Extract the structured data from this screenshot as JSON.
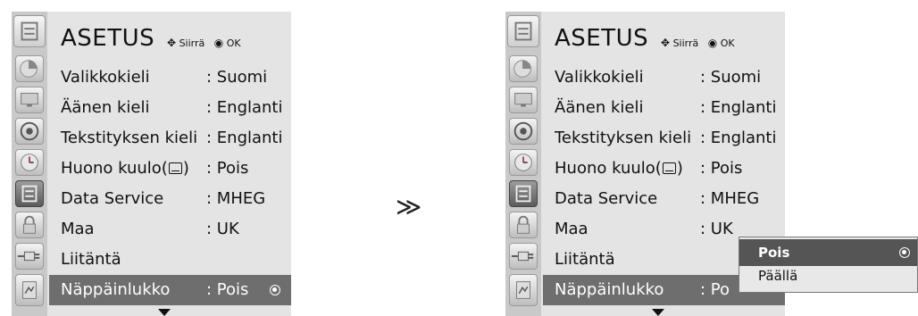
{
  "left_panel": {
    "title": "ASETUS",
    "hint_move": "Siirrä",
    "hint_ok": "OK",
    "rows": [
      {
        "label": "Valikkokieli",
        "value": ": Suomi"
      },
      {
        "label": "Äänen kieli",
        "value": ": Englanti"
      },
      {
        "label": "Tekstityksen kieli",
        "value": ": Englanti"
      },
      {
        "label": "Huono kuulo(",
        "label_suffix": ")",
        "value": ": Pois"
      },
      {
        "label": "Data Service",
        "value": ": MHEG"
      },
      {
        "label": "Maa",
        "value": ": UK"
      },
      {
        "label": "Liitäntä",
        "value": ""
      },
      {
        "label": "Näppäinlukko",
        "value": ": Pois"
      }
    ]
  },
  "transition_arrow": "≫",
  "right_panel": {
    "title": "ASETUS",
    "hint_move": "Siirrä",
    "hint_ok": "OK",
    "rows": [
      {
        "label": "Valikkokieli",
        "value": ": Suomi"
      },
      {
        "label": "Äänen kieli",
        "value": ": Englanti"
      },
      {
        "label": "Tekstityksen kieli",
        "value": ": Englanti"
      },
      {
        "label": "Huono kuulo(",
        "label_suffix": ")",
        "value": ": Pois"
      },
      {
        "label": "Data Service",
        "value": ": MHEG"
      },
      {
        "label": "Maa",
        "value": ": UK"
      },
      {
        "label": "Liitäntä",
        "value": ""
      },
      {
        "label": "Näppäinlukko",
        "value": ": Po"
      }
    ],
    "popup": {
      "options": [
        "Pois",
        "Päällä"
      ],
      "selected": "Pois"
    }
  },
  "sidebar_icons": [
    "setup-icon",
    "picture-icon",
    "monitor-icon",
    "audio-icon",
    "time-icon",
    "option-icon",
    "lock-icon",
    "input-icon",
    "usb-icon"
  ]
}
